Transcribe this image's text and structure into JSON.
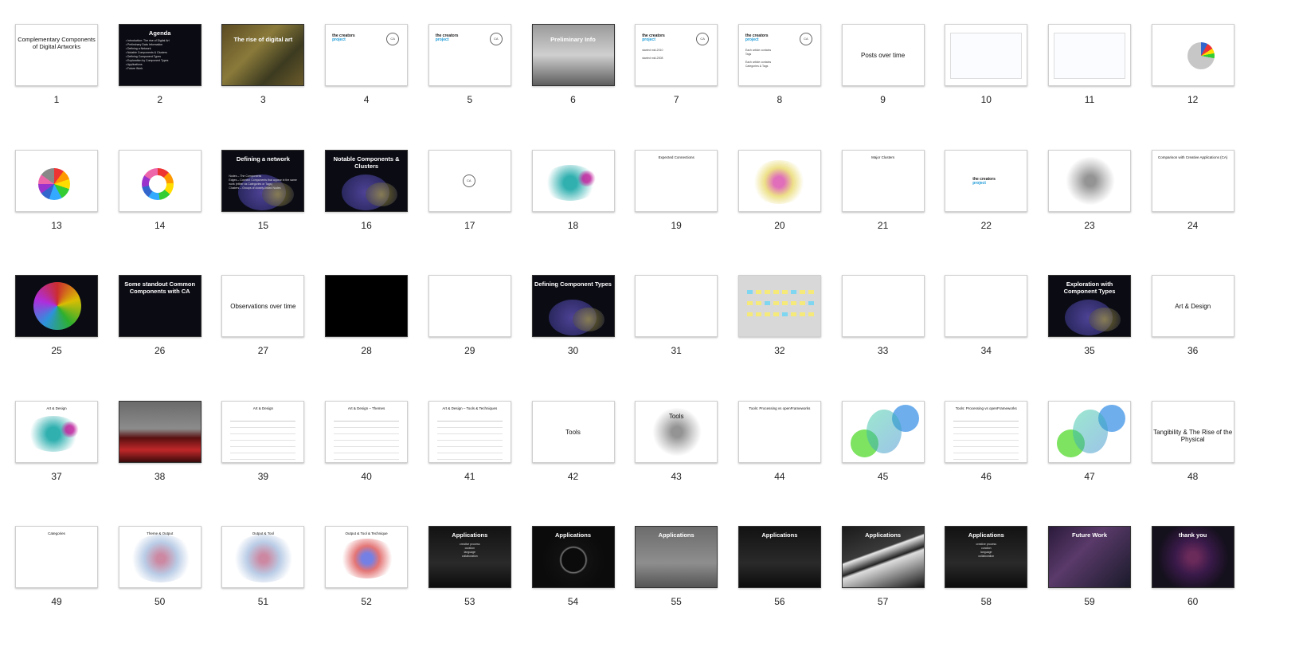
{
  "view": {
    "title": "Slide Sorter"
  },
  "slides": [
    {
      "n": "1",
      "title": "Complementary Components of Digital Artworks",
      "body": "",
      "style": "title"
    },
    {
      "n": "2",
      "title": "Agenda",
      "body": "• Introduction: The rise of Digital Art\n• Preliminary Data Information\n• Defining a Network\n• Notable Components & Clusters\n• Defining Component Types\n• Exploration by Component Types\n• Applications\n• Future Work",
      "style": "dark"
    },
    {
      "n": "3",
      "title": "The rise of digital art",
      "body": "",
      "style": "photo-circuit"
    },
    {
      "n": "4",
      "title": "",
      "body": "",
      "style": "logos"
    },
    {
      "n": "5",
      "title": "",
      "body": "",
      "style": "logos-text"
    },
    {
      "n": "6",
      "title": "Preliminary Info",
      "body": "",
      "style": "photo-gray"
    },
    {
      "n": "7",
      "title": "",
      "body": "started mid-2010\n\nstarted mid-2008",
      "style": "logos"
    },
    {
      "n": "8",
      "title": "",
      "body": "Each article contains\nTags\n\nEach article contains\nCategories & Tags",
      "style": "logos"
    },
    {
      "n": "9",
      "title": "Posts over time",
      "body": "",
      "style": "plain"
    },
    {
      "n": "10",
      "title": "",
      "body": "",
      "style": "linechart"
    },
    {
      "n": "11",
      "title": "",
      "body": "",
      "style": "linechart"
    },
    {
      "n": "12",
      "title": "",
      "body": "",
      "style": "pie-small"
    },
    {
      "n": "13",
      "title": "",
      "body": "",
      "style": "pie"
    },
    {
      "n": "14",
      "title": "",
      "body": "",
      "style": "donut"
    },
    {
      "n": "15",
      "title": "Defining a network",
      "body": "Nodes – The Components\nEdges – Connect Components that appear in the same work (either as Categories or Tags)\nClusters – Groups of closely-linked Nodes",
      "style": "dark-network"
    },
    {
      "n": "16",
      "title": "Notable Components & Clusters",
      "body": "",
      "style": "dark-network"
    },
    {
      "n": "17",
      "title": "",
      "body": "",
      "style": "logo-ca"
    },
    {
      "n": "18",
      "title": "",
      "body": "",
      "style": "network-teal"
    },
    {
      "n": "19",
      "title": "Expected Connections",
      "body": "",
      "style": "text"
    },
    {
      "n": "20",
      "title": "",
      "body": "",
      "style": "network-color"
    },
    {
      "n": "21",
      "title": "Major Clusters",
      "body": "",
      "style": "text"
    },
    {
      "n": "22",
      "title": "",
      "body": "",
      "style": "logo-cp"
    },
    {
      "n": "23",
      "title": "",
      "body": "",
      "style": "network-gray"
    },
    {
      "n": "24",
      "title": "Comparison with Creative Applications (CA)",
      "body": "",
      "style": "text"
    },
    {
      "n": "25",
      "title": "",
      "body": "",
      "style": "dark-burst"
    },
    {
      "n": "26",
      "title": "Some standout Common Components with CA",
      "body": "",
      "style": "dark"
    },
    {
      "n": "27",
      "title": "Observations over time",
      "body": "",
      "style": "plain"
    },
    {
      "n": "28",
      "title": "",
      "body": "",
      "style": "black"
    },
    {
      "n": "29",
      "title": "",
      "body": "",
      "style": "text"
    },
    {
      "n": "30",
      "title": "Defining Component Types",
      "body": "",
      "style": "dark-network"
    },
    {
      "n": "31",
      "title": "",
      "body": "",
      "style": "text"
    },
    {
      "n": "32",
      "title": "",
      "body": "",
      "style": "sticky"
    },
    {
      "n": "33",
      "title": "",
      "body": "",
      "style": "text"
    },
    {
      "n": "34",
      "title": "",
      "body": "",
      "style": "text"
    },
    {
      "n": "35",
      "title": "Exploration with Component Types",
      "body": "",
      "style": "dark-network"
    },
    {
      "n": "36",
      "title": "Art & Design",
      "body": "",
      "style": "plain"
    },
    {
      "n": "37",
      "title": "Art & Design",
      "body": "",
      "style": "network-teal"
    },
    {
      "n": "38",
      "title": "",
      "body": "",
      "style": "photo-red"
    },
    {
      "n": "39",
      "title": "Art & Design",
      "body": "",
      "style": "table"
    },
    {
      "n": "40",
      "title": "Art & Design – Themes",
      "body": "",
      "style": "table"
    },
    {
      "n": "41",
      "title": "Art & Design – Tools & Techniques",
      "body": "",
      "style": "table"
    },
    {
      "n": "42",
      "title": "Tools",
      "body": "",
      "style": "plain"
    },
    {
      "n": "43",
      "title": "Tools",
      "body": "",
      "style": "network-gray"
    },
    {
      "n": "44",
      "title": "Tools: Processing vs openFrameworks",
      "body": "",
      "style": "plain-top"
    },
    {
      "n": "45",
      "title": "",
      "body": "",
      "style": "green-diamond"
    },
    {
      "n": "46",
      "title": "Tools: Processing vs openFrameworks",
      "body": "",
      "style": "table"
    },
    {
      "n": "47",
      "title": "",
      "body": "",
      "style": "green-diamond"
    },
    {
      "n": "48",
      "title": "Tangibility & The Rise of the Physical",
      "body": "",
      "style": "plain"
    },
    {
      "n": "49",
      "title": "Categories",
      "body": "",
      "style": "text"
    },
    {
      "n": "50",
      "title": "Theme & Output",
      "body": "",
      "style": "network-pink"
    },
    {
      "n": "51",
      "title": "Output & Tool",
      "body": "",
      "style": "network-pink"
    },
    {
      "n": "52",
      "title": "Output & Tool & Technique",
      "body": "",
      "style": "network-dots"
    },
    {
      "n": "53",
      "title": "Applications",
      "body": "creative process\ncuration\nlanguage\ncollaboration",
      "style": "photo-dark"
    },
    {
      "n": "54",
      "title": "Applications",
      "body": "",
      "style": "photo-wheel"
    },
    {
      "n": "55",
      "title": "Applications",
      "body": "",
      "style": "photo-room"
    },
    {
      "n": "56",
      "title": "Applications",
      "body": "",
      "style": "photo-dark"
    },
    {
      "n": "57",
      "title": "Applications",
      "body": "",
      "style": "photo-piano"
    },
    {
      "n": "58",
      "title": "Applications",
      "body": "creative process\ncuration\nlanguage\ncollaboration",
      "style": "photo-dark"
    },
    {
      "n": "59",
      "title": "Future Work",
      "body": "",
      "style": "photo-future"
    },
    {
      "n": "60",
      "title": "thank you",
      "body": "",
      "style": "dark-purple"
    }
  ]
}
